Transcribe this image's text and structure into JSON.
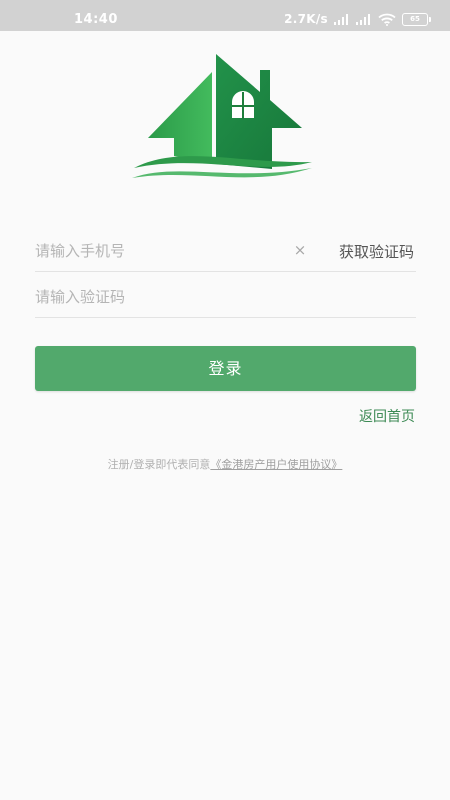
{
  "status_bar": {
    "time": "14:40",
    "network_speed": "2.7K/s",
    "battery_level": "65",
    "icons": [
      "signal-icon",
      "signal-hd-icon",
      "wifi-icon",
      "battery-icon"
    ]
  },
  "logo": {
    "icon": "house-logo-icon",
    "colors": {
      "green_light": "#3db85a",
      "green_dark": "#1e7e3c"
    }
  },
  "form": {
    "phone": {
      "placeholder": "请输入手机号",
      "value": ""
    },
    "clear_icon": "×",
    "get_code_label": "获取验证码",
    "code": {
      "placeholder": "请输入验证码",
      "value": ""
    }
  },
  "login_button": {
    "label": "登录"
  },
  "back_home_label": "返回首页",
  "agreement": {
    "prefix": "注册/登录即代表同意",
    "link": "《金港房产用户使用协议》"
  },
  "colors": {
    "accent": "#52a96c",
    "link": "#3d8a55",
    "status_bar": "#d2d2d2",
    "background": "#fafafa"
  }
}
